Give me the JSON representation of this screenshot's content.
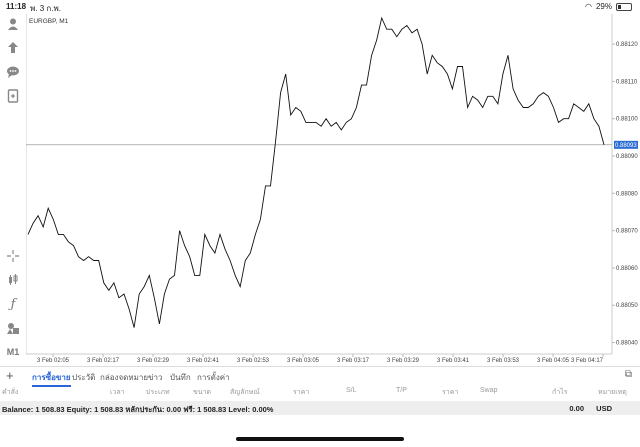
{
  "status_bar": {
    "time": "11:18",
    "date": "พ. 3 ก.พ.",
    "battery": "29%",
    "battery_level": 0.29
  },
  "toolbar": {
    "icons": [
      "account-icon",
      "trade-icon",
      "chat-icon",
      "document-icon",
      "crosshair-icon",
      "candles-icon",
      "indicator-icon",
      "objects-icon",
      "timeframe-label"
    ],
    "timeframe": "M1"
  },
  "chart": {
    "symbol_label": "EURGBP, M1",
    "current_price": "0.88093",
    "line_color": "#111111",
    "price_line_color": "#888888",
    "price_tag_color": "#2b6cd3"
  },
  "chart_data": {
    "type": "line",
    "title": "EURGBP, M1",
    "ylim": [
      0.88035,
      0.88125
    ],
    "y_ticks": [
      "0.88120",
      "0.88110",
      "0.88100",
      "0.88090",
      "0.88080",
      "0.88070",
      "0.88060",
      "0.88050",
      "0.88040"
    ],
    "x_ticks": [
      "3 Feb 02:05",
      "3 Feb 02:17",
      "3 Feb 02:29",
      "3 Feb 02:41",
      "3 Feb 02:53",
      "3 Feb 03:05",
      "3 Feb 03:17",
      "3 Feb 03:29",
      "3 Feb 03:41",
      "3 Feb 03:53",
      "3 Feb 04:05",
      "3 Feb 04:17"
    ],
    "values": [
      0.88069,
      0.88072,
      0.88074,
      0.88071,
      0.88076,
      0.88073,
      0.88069,
      0.88069,
      0.88067,
      0.88066,
      0.88063,
      0.88062,
      0.88063,
      0.88062,
      0.88062,
      0.88056,
      0.88054,
      0.88056,
      0.88052,
      0.88053,
      0.88049,
      0.88044,
      0.88053,
      0.88055,
      0.88058,
      0.88052,
      0.88045,
      0.88053,
      0.88057,
      0.88058,
      0.8807,
      0.88066,
      0.88063,
      0.88058,
      0.88058,
      0.88069,
      0.88066,
      0.88064,
      0.88069,
      0.88065,
      0.88062,
      0.88058,
      0.88055,
      0.88062,
      0.88064,
      0.88069,
      0.88073,
      0.88082,
      0.88082,
      0.88094,
      0.88107,
      0.88112,
      0.88101,
      0.88103,
      0.88102,
      0.88099,
      0.88099,
      0.88099,
      0.88098,
      0.881,
      0.88098,
      0.88099,
      0.88097,
      0.88099,
      0.881,
      0.88103,
      0.88109,
      0.88109,
      0.88117,
      0.88121,
      0.88127,
      0.88124,
      0.88124,
      0.88122,
      0.88124,
      0.88125,
      0.88123,
      0.88124,
      0.8812,
      0.88112,
      0.88117,
      0.88115,
      0.88114,
      0.88112,
      0.88108,
      0.88114,
      0.88114,
      0.88103,
      0.88106,
      0.88105,
      0.88103,
      0.88106,
      0.88106,
      0.88104,
      0.88112,
      0.88117,
      0.88108,
      0.88105,
      0.88103,
      0.88103,
      0.88104,
      0.88106,
      0.88107,
      0.88106,
      0.88103,
      0.88099,
      0.881,
      0.881,
      0.88104,
      0.88103,
      0.88102,
      0.88104,
      0.881,
      0.88098,
      0.88093
    ],
    "current_price": 0.88093,
    "grid": false
  },
  "tabs": [
    {
      "label": "การซื้อขาย",
      "active": true
    },
    {
      "label": "ประวัติ",
      "active": false
    },
    {
      "label": "กล่องจดหมาย",
      "active": false
    },
    {
      "label": "ข่าว",
      "active": false
    },
    {
      "label": "บันทึก",
      "active": false
    },
    {
      "label": "การตั้งค่า",
      "active": false
    }
  ],
  "table_headers": [
    "คำสั่ง",
    "เวลา",
    "ประเภท",
    "ขนาด",
    "สัญลักษณ์",
    "ราคา",
    "S/L",
    "T/P",
    "ราคา",
    "Swap",
    "กำไร",
    "หมายเหตุ"
  ],
  "balance": {
    "text": "Balance: 1 508.83 Equity: 1 508.83 หลักประกัน: 0.00 ฟรี: 1 508.83 Level: 0.00%",
    "profit": "0.00",
    "currency": "USD"
  }
}
